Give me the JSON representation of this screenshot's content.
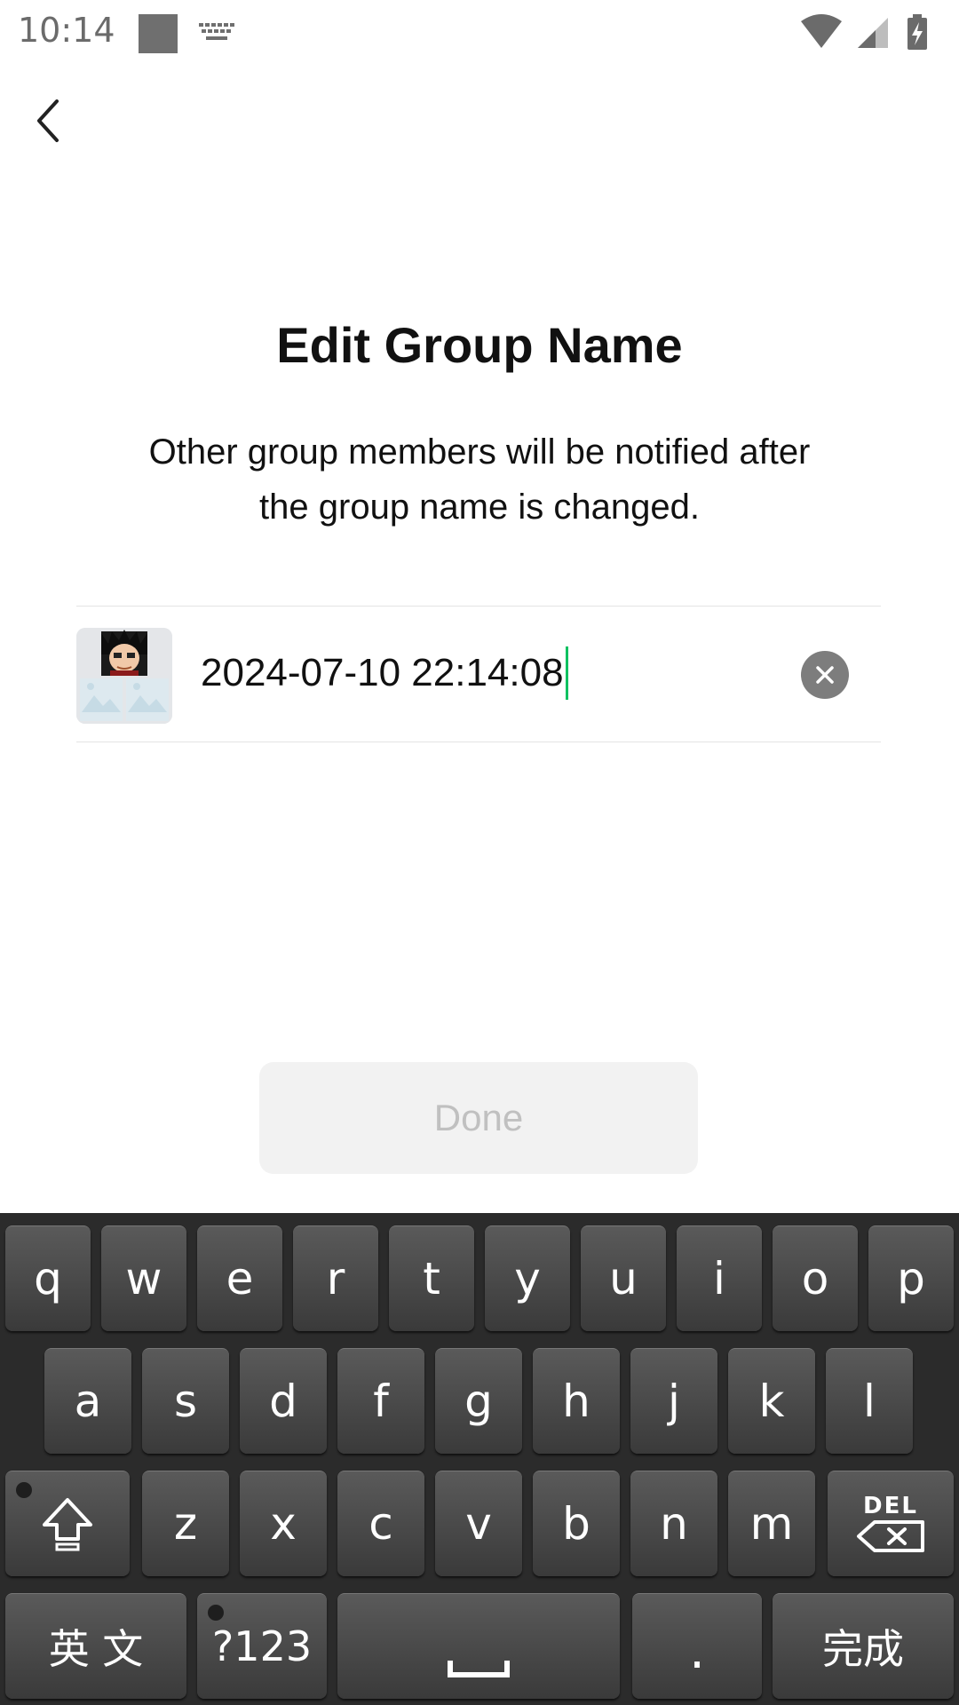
{
  "status_bar": {
    "time": "10:14",
    "icons": [
      "notification-square-icon",
      "keyboard-icon",
      "wifi-icon",
      "cell-signal-icon",
      "battery-charging-icon"
    ]
  },
  "header": {
    "back_icon": "chevron-left-icon"
  },
  "main": {
    "title": "Edit Group Name",
    "subtitle_line1": "Other group members will be notified after",
    "subtitle_line2": "the group name is changed.",
    "group_name_value": "2024-07-10 22:14:08",
    "clear_icon": "clear-x-icon",
    "done_label": "Done"
  },
  "keyboard": {
    "row1": [
      "q",
      "w",
      "e",
      "r",
      "t",
      "y",
      "u",
      "i",
      "o",
      "p"
    ],
    "row2": [
      "a",
      "s",
      "d",
      "f",
      "g",
      "h",
      "j",
      "k",
      "l"
    ],
    "row3": [
      "z",
      "x",
      "c",
      "v",
      "b",
      "n",
      "m"
    ],
    "shift_icon": "shift-arrow-icon",
    "delete_label": "DEL",
    "lang_label": "英 文",
    "symbols_label": "?123",
    "space_icon": "space-bar-icon",
    "period_label": ".",
    "done_label": "完成"
  },
  "colors": {
    "accent_caret": "#07c160",
    "done_disabled_bg": "#f2f2f2",
    "done_disabled_text": "#c0c0c0",
    "keyboard_bg": "#2b2b2b"
  }
}
